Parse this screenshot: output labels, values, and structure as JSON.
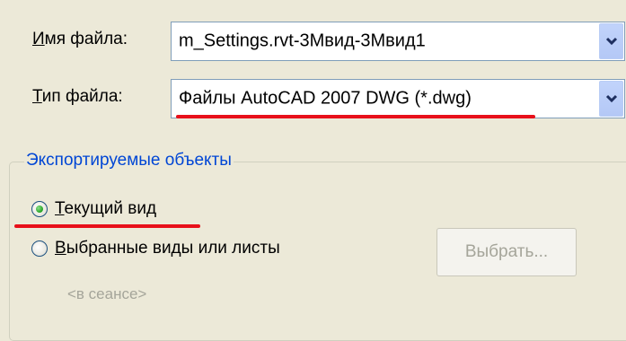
{
  "file_name": {
    "label_underlined": "И",
    "label_rest": "мя файла:",
    "value": "m_Settings.rvt-3Mвид-3Mвид1",
    "icon": "chevron-down-icon"
  },
  "file_type": {
    "label_underlined": "Т",
    "label_rest": "ип файла:",
    "value": "Файлы AutoCAD 2007 DWG (*.dwg)",
    "icon": "chevron-down-icon"
  },
  "export_group": {
    "title": "Экспортируемые объекты",
    "options": [
      {
        "underlined": "Т",
        "rest": "екущий вид",
        "selected": true
      },
      {
        "underlined": "В",
        "rest": "ыбранные виды или листы",
        "selected": false
      }
    ],
    "select_button": "Выбрать...",
    "session_label": "<в сеансе>"
  },
  "colors": {
    "highlight": "#e8101a",
    "group_title": "#0046d5",
    "disabled_text": "#a5a59a"
  }
}
